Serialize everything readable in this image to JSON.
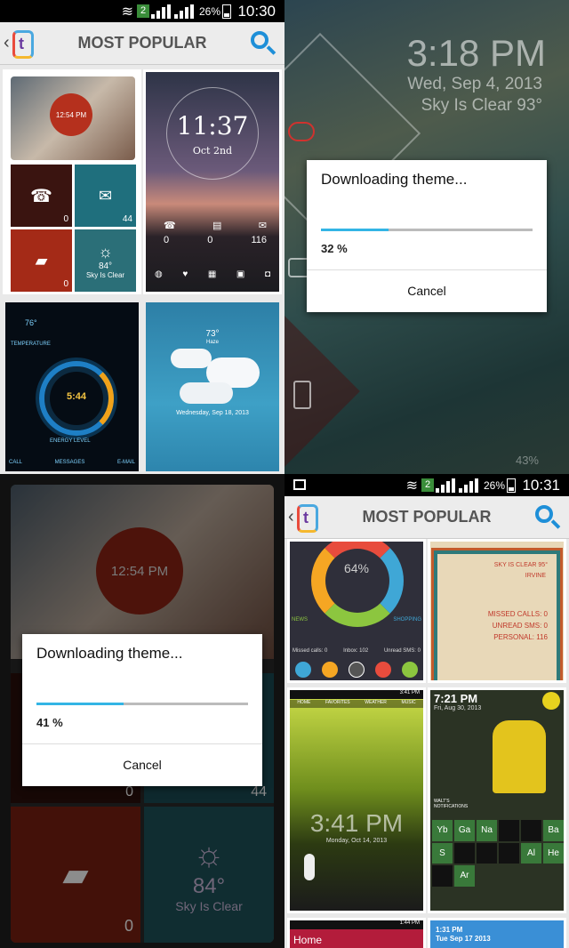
{
  "p1": {
    "status": {
      "time": "10:30",
      "battery": "26%",
      "sim": "2"
    },
    "title": "MOST POPULAR",
    "theme1": {
      "clock": "12:54 PM",
      "counts": [
        "0",
        "44",
        "0"
      ],
      "temp": "84°",
      "weather": "Sky Is Clear"
    },
    "theme2": {
      "time": "11:37",
      "date": "Oct  2nd",
      "counts": [
        "0",
        "0",
        "116"
      ]
    },
    "theme3": {
      "time": "5:44",
      "label1": "TEMPERATURE",
      "label2": "ENERGY LEVEL",
      "tabs": [
        "CALL",
        "MESSAGES",
        "E-MAIL"
      ],
      "temp": "76°"
    },
    "theme4": {
      "temp": "73°",
      "cond": "Haze",
      "date": "Wednesday, Sep 18, 2013"
    }
  },
  "p2": {
    "time": "3:18 PM",
    "date": "Wed, Sep 4, 2013",
    "weather": "Sky Is Clear  93°",
    "battery": "43%",
    "dialog": {
      "title": "Downloading theme...",
      "progress": 0.32,
      "percent": "32 %",
      "cancel": "Cancel"
    }
  },
  "p3": {
    "clock": "12:54 PM",
    "temp": "84°",
    "weather": "Sky Is Clear",
    "counts": [
      "0",
      "44",
      "0"
    ],
    "dialog": {
      "title": "Downloading theme...",
      "progress": 0.41,
      "percent": "41 %",
      "cancel": "Cancel"
    }
  },
  "p4": {
    "status": {
      "time": "10:31",
      "battery": "26%",
      "sim": "2"
    },
    "title": "MOST POPULAR",
    "t1": {
      "pct": "64%",
      "news": "NEWS",
      "shopping": "SHOPPING",
      "missed": "Missed calls: 0",
      "inbox": "Inbox: 102",
      "unread": "Unread SMS: 0"
    },
    "t2": {
      "weather": "SKY IS CLEAR 95°",
      "city": "IRVINE",
      "missed": "MISSED CALLS: 0",
      "unread": "UNREAD SMS: 0",
      "personal": "PERSONAL: 116"
    },
    "t3": {
      "time": "3:41 PM",
      "date": "Monday, Oct 14, 2013",
      "tabs": [
        "HOME",
        "FAVORITES",
        "WEATHER",
        "MUSIC"
      ],
      "status_time": "3:41 PM"
    },
    "t4": {
      "time": "7:21 PM",
      "date": "Fri, Aug 30, 2013",
      "notif": "WALT'S NOTIFICATIONS",
      "elements": [
        "Yb",
        "Ga",
        "Na",
        "Ba",
        "S",
        "Al",
        "He",
        "Ar"
      ]
    },
    "t5": {
      "home": "Home",
      "status_time": "1:44 PM"
    },
    "t6": {
      "time": "1:31 PM",
      "date": "Tue Sep 17 2013"
    }
  }
}
